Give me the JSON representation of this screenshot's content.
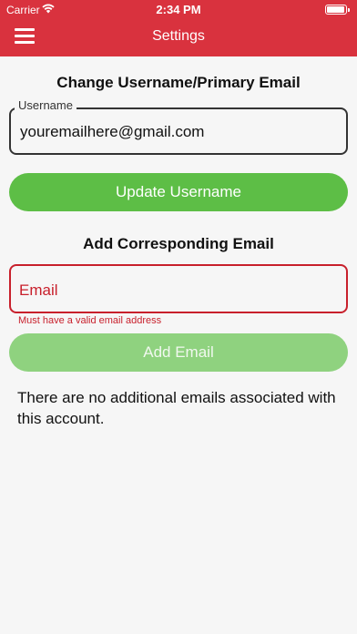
{
  "status_bar": {
    "carrier": "Carrier",
    "time": "2:34 PM"
  },
  "nav": {
    "title": "Settings",
    "menu_icon": "hamburger-menu-icon"
  },
  "change_section": {
    "title": "Change Username/Primary Email",
    "username_label": "Username",
    "username_value": "youremailhere@gmail.com",
    "update_button": "Update Username"
  },
  "add_section": {
    "title": "Add Corresponding Email",
    "email_placeholder": "Email",
    "error_message": "Must have a valid email address",
    "add_button": "Add Email"
  },
  "info": {
    "no_emails_message": "There are no additional emails associated with this account."
  },
  "colors": {
    "header": "#d9323e",
    "primary_button": "#5dbe46",
    "disabled_button": "#8fd27f",
    "error": "#c8202c"
  }
}
